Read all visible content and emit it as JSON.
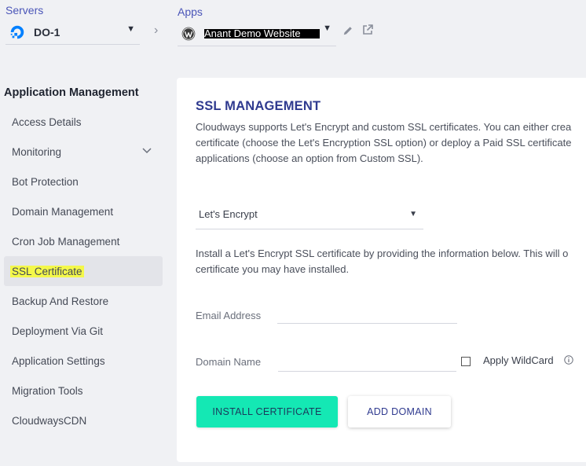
{
  "header": {
    "servers_label": "Servers",
    "server_name": "DO-1",
    "apps_label": "Apps",
    "app_name": "Anant Demo Website"
  },
  "sidebar": {
    "title": "Application Management",
    "items": [
      {
        "label": "Access Details"
      },
      {
        "label": "Monitoring"
      },
      {
        "label": "Bot Protection"
      },
      {
        "label": "Domain Management"
      },
      {
        "label": "Cron Job Management"
      },
      {
        "label": "SSL Certificate"
      },
      {
        "label": "Backup And Restore"
      },
      {
        "label": "Deployment Via Git"
      },
      {
        "label": "Application Settings"
      },
      {
        "label": "Migration Tools"
      },
      {
        "label": "CloudwaysCDN"
      }
    ],
    "active_index": 5
  },
  "main": {
    "title": "SSL MANAGEMENT",
    "description_lines": [
      "Cloudways supports Let's Encrypt and custom SSL certificates. You can either crea",
      "certificate (choose the Let's Encryption SSL option) or deploy a Paid SSL certificate",
      "applications (choose an option from Custom SSL)."
    ],
    "ssl_type_selected": "Let's Encrypt",
    "install_description_lines": [
      "Install a Let's Encrypt SSL certificate by providing the information below. This will o",
      "certificate you may have installed."
    ],
    "email_label": "Email Address",
    "email_value": "",
    "domain_label": "Domain Name",
    "domain_value": "",
    "wildcard_label": "Apply WildCard",
    "install_button": "INSTALL CERTIFICATE",
    "add_domain_button": "ADD DOMAIN"
  },
  "colors": {
    "accent": "#2f3a8f",
    "install_button": "#14e8b4",
    "highlight": "#f4f84a",
    "active_nav_bg": "#e3e4e9",
    "page_bg": "#f0f1f4"
  }
}
